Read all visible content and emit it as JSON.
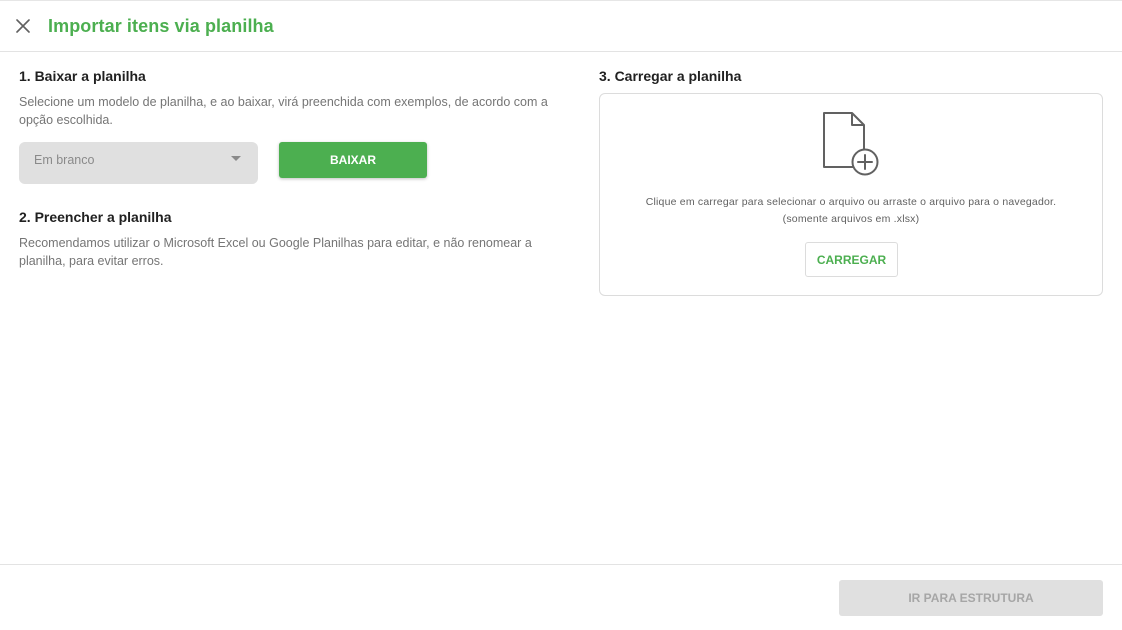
{
  "header": {
    "close_icon": "close-icon",
    "title": "Importar itens via planilha"
  },
  "step1": {
    "title": "1. Baixar a planilha",
    "description": "Selecione um modelo de planilha, e ao baixar, virá preenchida com exemplos, de acordo com a opção escolhida.",
    "template_select": {
      "selected": "Em branco",
      "icon": "chevron-down-icon"
    },
    "download_label": "BAIXAR"
  },
  "step2": {
    "title": "2. Preencher a planilha",
    "description": "Recomendamos utilizar o Microsoft Excel ou Google Planilhas para editar, e não renomear a planilha, para evitar erros."
  },
  "step3": {
    "title": "3. Carregar a planilha",
    "file_icon": "file-add-icon",
    "instructions": "Clique em carregar para selecionar o arquivo ou arraste o arquivo para o navegador.",
    "file_hint": "(somente arquivos em .xlsx)",
    "upload_label": "CARREGAR"
  },
  "footer": {
    "next_label": "IR PARA ESTRUTURA"
  },
  "colors": {
    "accent": "#4caf50",
    "disabled_bg": "#e0e0e0",
    "disabled_text": "#a6a6a6"
  }
}
